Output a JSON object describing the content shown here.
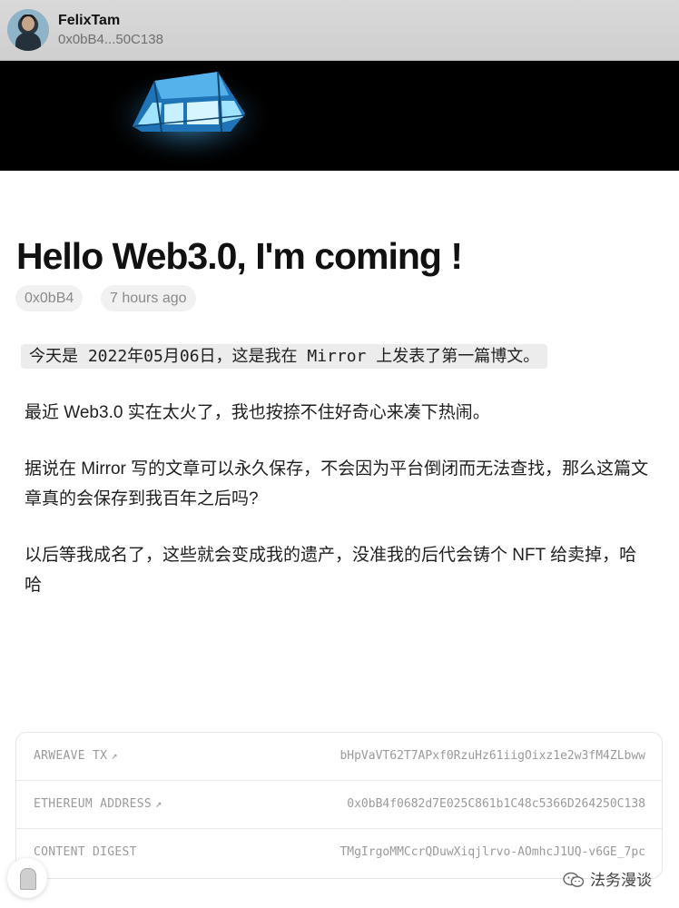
{
  "header": {
    "username": "FelixTam",
    "address_short": "0x0bB4...50C138"
  },
  "banner": {
    "image": "tent-night-icon"
  },
  "post": {
    "title": "Hello Web3.0, I'm coming !",
    "author_pill": "0x0bB4",
    "time_pill": "7 hours ago",
    "paragraphs": [
      "今天是 2022年05月06日，这是我在 Mirror 上发表了第一篇博文。",
      "最近 Web3.0 实在太火了，我也按捺不住好奇心来凑下热闹。",
      "据说在 Mirror 写的文章可以永久保存，不会因为平台倒闭而无法查找，那么这篇文章真的会保存到我百年之后吗?",
      "以后等我成名了，这些就会变成我的遗产，没准我的后代会铸个 NFT 给卖掉，哈哈"
    ]
  },
  "meta": {
    "rows": [
      {
        "key": "ARWEAVE TX",
        "arrow": "↗",
        "value": "bHpVaVT62T7APxf0RzuHz61iigOixz1e2w3fM4ZLbww"
      },
      {
        "key": "ETHEREUM ADDRESS",
        "arrow": "↗",
        "value": "0x0bB4f0682d7E025C861b1C48c5366D264250C138"
      },
      {
        "key": "CONTENT DIGEST",
        "arrow": "",
        "value": "TMgIrgoMMCcrQDuwXiqjlrvo-AOmhcJ1UQ-v6GE_7pc"
      }
    ]
  },
  "watermark": {
    "text": "法务漫谈",
    "icon": "wechat-icon"
  }
}
